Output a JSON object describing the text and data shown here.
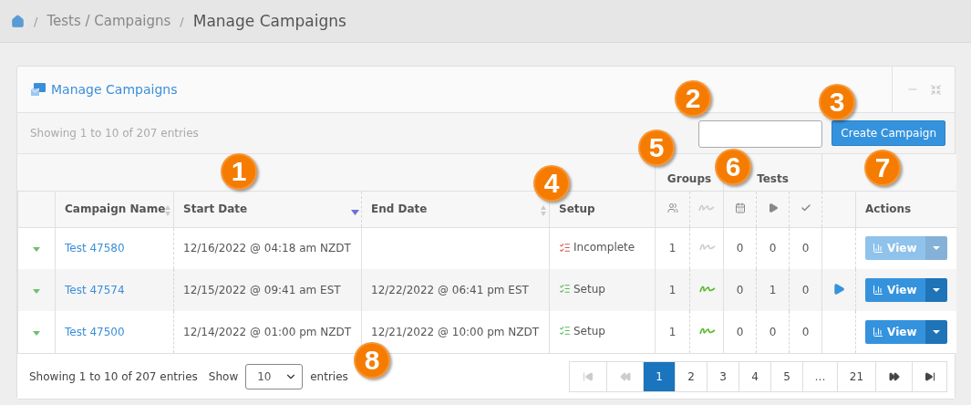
{
  "breadcrumb": [
    {
      "separator": "/",
      "label": "Tests / Campaigns"
    },
    {
      "separator": "/",
      "label": "Manage Campaigns"
    }
  ],
  "panel": {
    "title": "Manage Campaigns"
  },
  "toolbar": {
    "info": "Showing 1 to 10 of 207 entries",
    "create_button": "Create Campaign"
  },
  "column_groups": [
    {
      "label": "Groups"
    },
    {
      "label": "Tests"
    }
  ],
  "columns": [
    {
      "kind": "blank"
    },
    {
      "kind": "sortable",
      "label": "Campaign Name"
    },
    {
      "kind": "sorted",
      "label": "Start Date"
    },
    {
      "kind": "sortable",
      "label": "End Date"
    },
    {
      "kind": "plain",
      "label": "Setup"
    },
    {
      "kind": "icon"
    },
    {
      "kind": "icon"
    },
    {
      "kind": "icon"
    },
    {
      "kind": "icon"
    },
    {
      "kind": "icon"
    },
    {
      "kind": "blank"
    },
    {
      "kind": "plain",
      "label": "Actions"
    }
  ],
  "rows": [
    {
      "name": "Test 47580",
      "start": "12/16/2022 @ 04:18 am NZDT",
      "end": "",
      "setup": {
        "label": "Incomplete",
        "complete": false
      },
      "groups": "1",
      "signed": false,
      "scheduled": "0",
      "running": "0",
      "completed": "0",
      "playing": false,
      "view": {
        "label": "View",
        "disabled": true
      }
    },
    {
      "name": "Test 47574",
      "start": "12/15/2022 @ 09:41 am EST",
      "end": "12/22/2022 @ 06:41 pm EST",
      "setup": {
        "label": "Setup",
        "complete": true
      },
      "groups": "1",
      "signed": true,
      "scheduled": "0",
      "running": "1",
      "completed": "0",
      "playing": true,
      "view": {
        "label": "View",
        "disabled": false
      }
    },
    {
      "name": "Test 47500",
      "start": "12/14/2022 @ 01:00 pm NZDT",
      "end": "12/21/2022 @ 10:00 pm NZDT",
      "setup": {
        "label": "Setup",
        "complete": true
      },
      "groups": "1",
      "signed": true,
      "scheduled": "0",
      "running": "0",
      "completed": "0",
      "playing": false,
      "view": {
        "label": "View",
        "disabled": false
      }
    }
  ],
  "footer": {
    "info": "Showing 1 to 10 of 207 entries",
    "show_label": "Show",
    "page_size": "10",
    "entries_label": "entries"
  },
  "pagination": {
    "first_disabled": true,
    "prev_disabled": true,
    "pages": [
      {
        "label": "1",
        "selected": true
      },
      {
        "label": "2",
        "selected": false
      },
      {
        "label": "3",
        "selected": false
      },
      {
        "label": "4",
        "selected": false
      },
      {
        "label": "5",
        "selected": false
      },
      {
        "label": "…",
        "kind": "gap"
      },
      {
        "label": "21",
        "selected": false
      }
    ]
  },
  "callouts": [
    "1",
    "2",
    "3",
    "4",
    "5",
    "6",
    "7",
    "8"
  ]
}
